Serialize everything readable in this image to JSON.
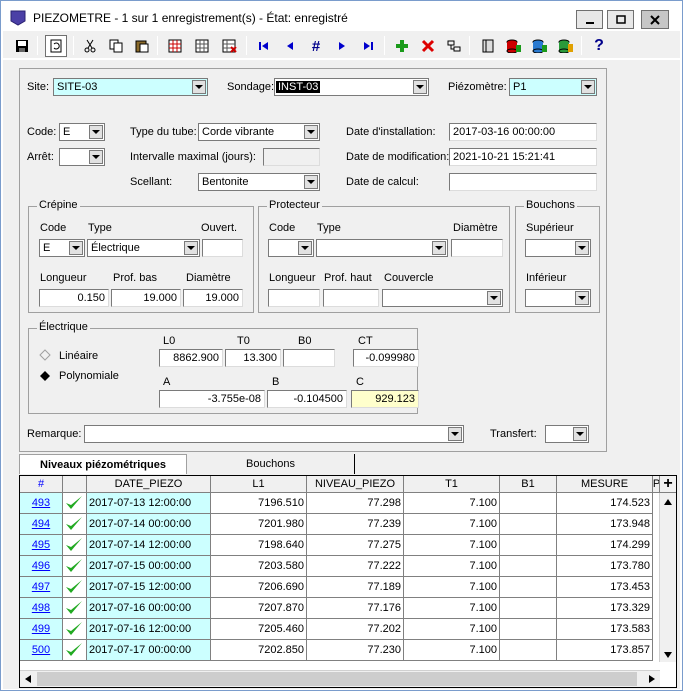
{
  "window": {
    "title": "PIEZOMETRE - 1 sur 1 enregistrement(s) - État: enregistré"
  },
  "toolbar": {
    "icons": [
      "save-icon",
      "refresh-icon",
      "cut-icon",
      "copy-icon",
      "paste-icon",
      "table-icon",
      "grid-icon",
      "delete-grid-icon",
      "first-record-icon",
      "prev-record-icon",
      "goto-record-icon",
      "next-record-icon",
      "last-record-icon",
      "add-record-icon",
      "delete-record-icon",
      "link-icon",
      "book-icon",
      "database-icon",
      "database-green-icon",
      "database-edit-icon",
      "help-icon"
    ],
    "help_label": "?",
    "goto_label": "#"
  },
  "header": {
    "site_label": "Site:",
    "site_value": "SITE-03",
    "sondage_label": "Sondage:",
    "sondage_value": "INST-03",
    "piezometre_label": "Piézomètre:",
    "piezometre_value": "P1"
  },
  "form": {
    "code_label": "Code:",
    "code_value": "E",
    "arret_label": "Arrêt:",
    "arret_value": "",
    "type_tube_label": "Type du tube:",
    "type_tube_value": "Corde vibrante",
    "intervalle_label": "Intervalle maximal (jours):",
    "intervalle_value": "",
    "scellant_label": "Scellant:",
    "scellant_value": "Bentonite",
    "date_install_label": "Date d'installation:",
    "date_install_value": "2017-03-16 00:00:00",
    "date_modif_label": "Date de modification:",
    "date_modif_value": "2021-10-21 15:21:41",
    "date_calcul_label": "Date de calcul:",
    "date_calcul_value": ""
  },
  "crepine": {
    "title": "Crépine",
    "code_label": "Code",
    "code_value": "E",
    "type_label": "Type",
    "type_value": "Électrique",
    "ouvert_label": "Ouvert.",
    "ouvert_value": "",
    "longueur_label": "Longueur",
    "longueur_value": "0.150",
    "prof_bas_label": "Prof. bas",
    "prof_bas_value": "19.000",
    "diametre_label": "Diamètre",
    "diametre_value": "19.000"
  },
  "protecteur": {
    "title": "Protecteur",
    "code_label": "Code",
    "type_label": "Type",
    "diametre_label": "Diamètre",
    "longueur_label": "Longueur",
    "prof_haut_label": "Prof. haut",
    "couvercle_label": "Couvercle"
  },
  "bouchons": {
    "title": "Bouchons",
    "superieur_label": "Supérieur",
    "inferieur_label": "Inférieur"
  },
  "electrique": {
    "title": "Électrique",
    "lineaire_label": "Linéaire",
    "polynomiale_label": "Polynomiale",
    "selected": "Polynomiale",
    "L0_label": "L0",
    "L0_value": "8862.900",
    "T0_label": "T0",
    "T0_value": "13.300",
    "B0_label": "B0",
    "B0_value": "",
    "CT_label": "CT",
    "CT_value": "-0.099980",
    "A_label": "A",
    "A_value": "-3.755e-08",
    "B_label": "B",
    "B_value": "-0.104500",
    "C_label": "C",
    "C_value": "929.123"
  },
  "remarque": {
    "label": "Remarque:",
    "value": "",
    "transfert_label": "Transfert:",
    "transfert_value": ""
  },
  "tabs": [
    {
      "label": "Niveaux piézométriques",
      "active": true
    },
    {
      "label": "Bouchons",
      "active": false
    }
  ],
  "grid": {
    "columns": [
      "#",
      "",
      "DATE_PIEZO",
      "L1",
      "NIVEAU_PIEZO",
      "T1",
      "B1",
      "MESURE",
      "P"
    ],
    "add_label": "+",
    "rows": [
      {
        "num": "493",
        "checked": true,
        "date": "2017-07-13 12:00:00",
        "l1": "7196.510",
        "niveau": "77.298",
        "t1": "7.100",
        "b1": "",
        "mesure": "174.523"
      },
      {
        "num": "494",
        "checked": true,
        "date": "2017-07-14 00:00:00",
        "l1": "7201.980",
        "niveau": "77.239",
        "t1": "7.100",
        "b1": "",
        "mesure": "173.948"
      },
      {
        "num": "495",
        "checked": true,
        "date": "2017-07-14 12:00:00",
        "l1": "7198.640",
        "niveau": "77.275",
        "t1": "7.100",
        "b1": "",
        "mesure": "174.299"
      },
      {
        "num": "496",
        "checked": true,
        "date": "2017-07-15 00:00:00",
        "l1": "7203.580",
        "niveau": "77.222",
        "t1": "7.100",
        "b1": "",
        "mesure": "173.780"
      },
      {
        "num": "497",
        "checked": true,
        "date": "2017-07-15 12:00:00",
        "l1": "7206.690",
        "niveau": "77.189",
        "t1": "7.100",
        "b1": "",
        "mesure": "173.453"
      },
      {
        "num": "498",
        "checked": true,
        "date": "2017-07-16 00:00:00",
        "l1": "7207.870",
        "niveau": "77.176",
        "t1": "7.100",
        "b1": "",
        "mesure": "173.329"
      },
      {
        "num": "499",
        "checked": true,
        "date": "2017-07-16 12:00:00",
        "l1": "7205.460",
        "niveau": "77.202",
        "t1": "7.100",
        "b1": "",
        "mesure": "173.583"
      },
      {
        "num": "500",
        "checked": true,
        "date": "2017-07-17 00:00:00",
        "l1": "7202.850",
        "niveau": "77.230",
        "t1": "7.100",
        "b1": "",
        "mesure": "173.857"
      }
    ]
  },
  "colors": {
    "accent": "#0000ff",
    "cyan": "#ccffff",
    "yellow": "#ffffcc",
    "check": "#22aa22"
  }
}
